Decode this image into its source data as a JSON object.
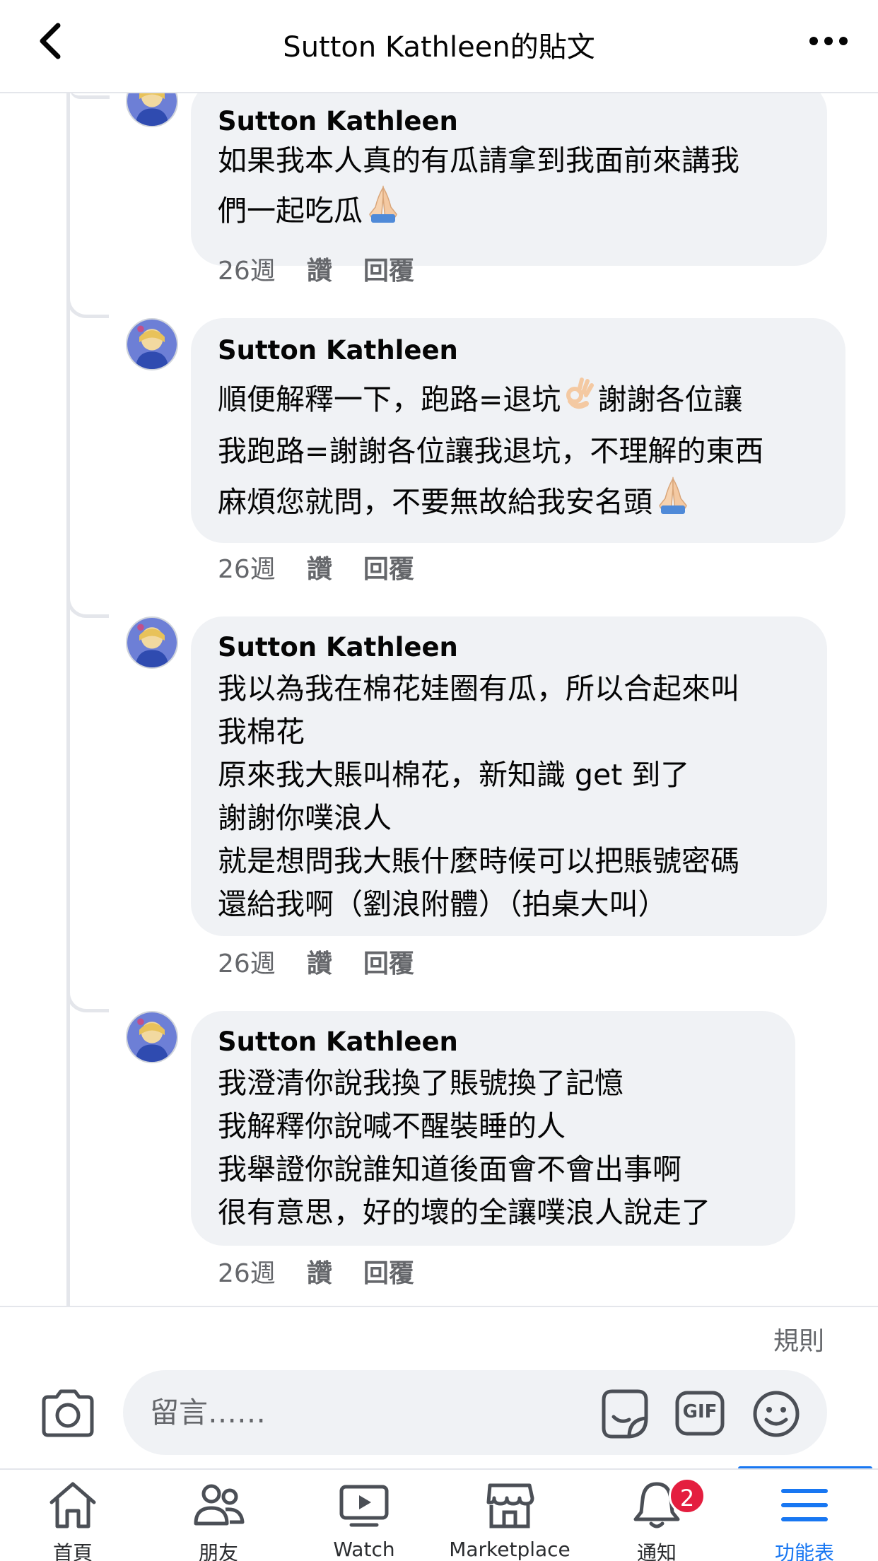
{
  "header": {
    "title": "Sutton Kathleen的貼文"
  },
  "comments": [
    {
      "author": "Sutton Kathleen",
      "lines": [
        "如果我本人真的有瓜請拿到我面前來講我",
        "們一起吃瓜"
      ],
      "age": "26週",
      "like_label": "讚",
      "reply_label": "回覆"
    },
    {
      "author": "Sutton Kathleen",
      "lines": [
        "順便解釋一下，跑路=退坑",
        "謝謝各位讓",
        "我跑路=謝謝各位讓我退坑，不理解的東西",
        "麻煩您就問，不要無故給我安名頭"
      ],
      "age": "26週",
      "like_label": "讚",
      "reply_label": "回覆"
    },
    {
      "author": "Sutton Kathleen",
      "lines": [
        "我以為我在棉花娃圈有瓜，所以合起來叫",
        "我棉花",
        "原來我大賬叫棉花，新知識 get 到了",
        "謝謝你噗浪人",
        "就是想問我大賬什麼時候可以把賬號密碼",
        "還給我啊（劉浪附體）（拍桌大叫）"
      ],
      "age": "26週",
      "like_label": "讚",
      "reply_label": "回覆"
    },
    {
      "author": "Sutton Kathleen",
      "lines": [
        "我澄清你說我換了賬號換了記憶",
        "我解釋你說喊不醒裝睡的人",
        "我舉證你說誰知道後面會不會出事啊",
        "很有意思，好的壞的全讓噗浪人說走了"
      ],
      "age": "26週",
      "like_label": "讚",
      "reply_label": "回覆"
    }
  ],
  "composer": {
    "rules_label": "規則",
    "placeholder": "留言……",
    "gif_label": "GIF"
  },
  "tabs": [
    {
      "label": "首頁",
      "icon": "home-icon"
    },
    {
      "label": "朋友",
      "icon": "friends-icon"
    },
    {
      "label": "Watch",
      "icon": "watch-icon"
    },
    {
      "label": "Marketplace",
      "icon": "marketplace-icon"
    },
    {
      "label": "通知",
      "icon": "bell-icon",
      "badge": "2"
    },
    {
      "label": "功能表",
      "icon": "menu-icon",
      "active": true
    }
  ],
  "colors": {
    "accent": "#1877f2",
    "bubble": "#f0f2f5",
    "meta_text": "#65676b",
    "badge": "#e41e3f"
  }
}
